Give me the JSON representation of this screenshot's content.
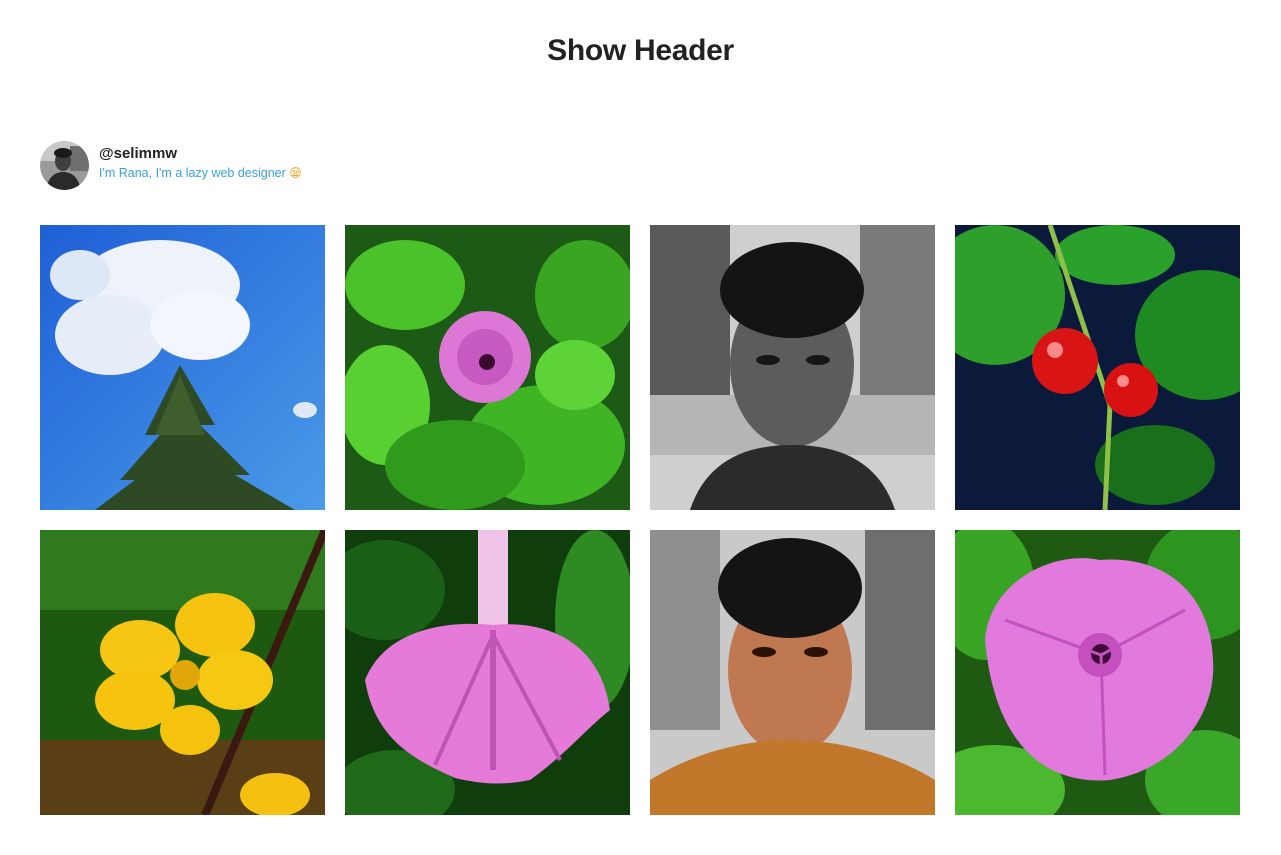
{
  "header": {
    "title": "Show Header"
  },
  "profile": {
    "username": "@selimmw",
    "bio": "I'm Rana, I'm a lazy web designer",
    "bio_emoji": "😪"
  },
  "colors": {
    "title": "#222222",
    "bio_link": "#3aa0d8",
    "background": "#ffffff"
  },
  "gallery": {
    "photos": [
      {
        "subject": "sky-with-tree"
      },
      {
        "subject": "pink-flower-leaves"
      },
      {
        "subject": "portrait-black-white"
      },
      {
        "subject": "red-berries"
      },
      {
        "subject": "yellow-flower"
      },
      {
        "subject": "pink-flower-trumpet"
      },
      {
        "subject": "portrait-color"
      },
      {
        "subject": "pink-flower-front"
      }
    ]
  }
}
